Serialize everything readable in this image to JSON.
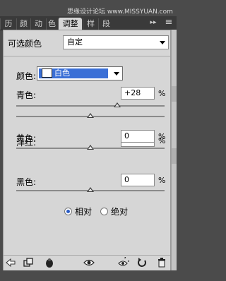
{
  "watermark": "思缘设计论坛  www.MISSYUAN.com",
  "tabs": [
    {
      "label": "历"
    },
    {
      "label": "颜"
    },
    {
      "label": "动"
    },
    {
      "label": "色"
    },
    {
      "label": "调整"
    },
    {
      "label": "样"
    },
    {
      "label": "段"
    }
  ],
  "tab_menu_icon": "▸▸",
  "tab_panel_menu_icon": "≡",
  "preset": {
    "label": "可选颜色",
    "value": "自定"
  },
  "color": {
    "label": "颜色:",
    "value": "白色"
  },
  "sliders": [
    {
      "label": "青色:",
      "value": "+28",
      "unit": "%",
      "fraction": 0.68
    },
    {
      "label": "洋红:",
      "value": "0",
      "unit": "%",
      "fraction": 0.5
    },
    {
      "label": "黄色:",
      "value": "0",
      "unit": "%",
      "fraction": 0.5
    },
    {
      "label": "黑色:",
      "value": "0",
      "unit": "%",
      "fraction": 0.5
    }
  ],
  "method": {
    "relative": "相对",
    "absolute": "绝对",
    "selected": "relative"
  },
  "bottom_icons": [
    "back-icon",
    "clip-layer-icon",
    "mask-icon",
    "eye-icon",
    "view-previous-icon",
    "reset-icon",
    "trash-icon"
  ],
  "colors": {
    "selection": "#3a6fd6",
    "panel": "#d6d6d6",
    "tab_bar": "#3a3a3a"
  }
}
